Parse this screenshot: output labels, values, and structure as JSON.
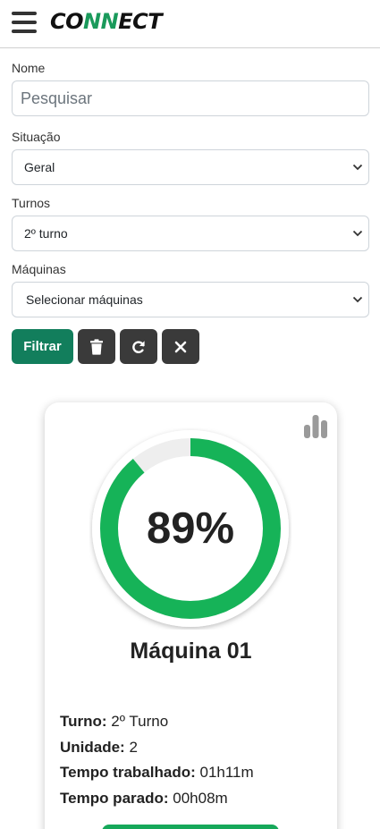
{
  "header": {
    "logo_prefix": "CO",
    "logo_highlight": "NN",
    "logo_suffix": "ECT",
    "logo_accent_color": "#1a9a5b"
  },
  "filters": {
    "name": {
      "label": "Nome",
      "placeholder": "Pesquisar",
      "value": ""
    },
    "situacao": {
      "label": "Situação",
      "selected": "Geral"
    },
    "turnos": {
      "label": "Turnos",
      "selected": "2º turno"
    },
    "maquinas": {
      "label": "Máquinas",
      "selected": "Selecionar máquinas"
    }
  },
  "buttons": {
    "filter_label": "Filtrar",
    "delete_icon": "trash-icon",
    "refresh_icon": "refresh-icon",
    "clear_icon": "close-icon",
    "primary_color": "#127e5c"
  },
  "machine_card": {
    "percent_text": "89%",
    "percent_value": 89,
    "gauge_color": "#16b358",
    "name": "Máquina 01",
    "details": [
      {
        "label": "Turno:",
        "value": "2º Turno"
      },
      {
        "label": "Unidade:",
        "value": "2"
      },
      {
        "label": "Tempo trabalhado:",
        "value": "01h11m"
      },
      {
        "label": "Tempo parado:",
        "value": "00h08m"
      }
    ]
  }
}
